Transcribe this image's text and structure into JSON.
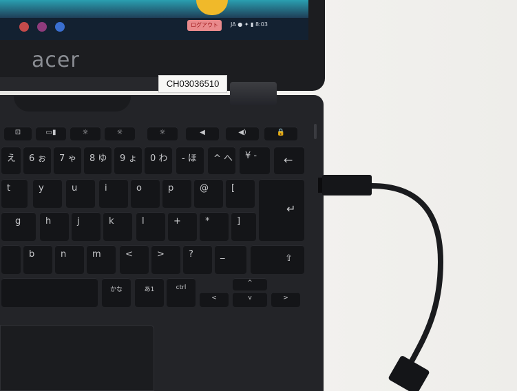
{
  "brand": "acer",
  "asset_tag": "CH03036510",
  "status_tag": "ログアウト",
  "status_text": "JA ● ✦ ▮ 8:03",
  "keys": {
    "function_row": [
      "⊡",
      "▭▮",
      "☼",
      "☼",
      "☼",
      "◀",
      "◀)",
      "🔒"
    ],
    "row_tilde": [
      "え",
      "6 ぉ",
      "7 ゃ",
      "8 ゆ",
      "9 ょ",
      "0 わ",
      "- ほ",
      "^ へ",
      "¥ -",
      "←"
    ],
    "row_qwerty": [
      "t",
      "y",
      "u",
      "i",
      "o",
      "p",
      "@",
      "[",
      "↵"
    ],
    "row_home": [
      "g",
      "h",
      "j",
      "k",
      "l",
      "+",
      "*",
      "]"
    ],
    "row_bottom": [
      "b",
      "n",
      "m",
      "<",
      ">",
      "?",
      "_",
      "⇧"
    ],
    "row_space": [
      "かな",
      "あ1",
      "ctrl"
    ],
    "arrows": [
      "<",
      "^",
      "v",
      ">"
    ]
  },
  "colors": {
    "tabletop": "#ecebe8",
    "laptop": "#232428",
    "key": "#141518"
  }
}
